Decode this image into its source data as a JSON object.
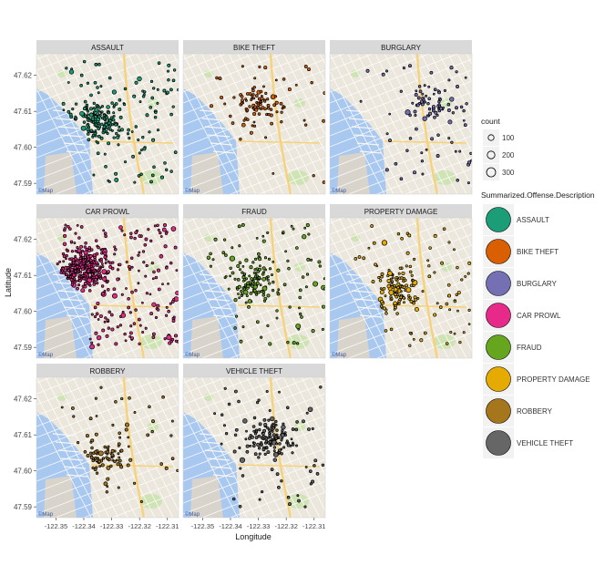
{
  "chart_data": {
    "type": "scatter",
    "subtype": "faceted map scatter (small multiples on street-map tiles)",
    "xlabel": "Longitude",
    "ylabel": "Latitude",
    "xlim": [
      -122.357,
      -122.306
    ],
    "ylim": [
      47.587,
      47.626
    ],
    "x_ticks": [
      -122.35,
      -122.34,
      -122.33,
      -122.32,
      -122.31
    ],
    "x_tick_labels": [
      "-122.35",
      "-122.34",
      "-122.33",
      "-122.32",
      "-122.31"
    ],
    "y_ticks": [
      47.59,
      47.6,
      47.61,
      47.62
    ],
    "y_tick_labels": [
      "47.59",
      "47.60",
      "47.61",
      "47.62"
    ],
    "grid": false,
    "legend_position": "right",
    "size_legend": {
      "title": "count",
      "breaks": [
        100,
        200,
        300
      ],
      "labels": [
        "100",
        "200",
        "300"
      ]
    },
    "color_legend": {
      "title": "Summarized.Offense.Description",
      "entries": [
        {
          "label": "ASSAULT",
          "color": "#1b9e77"
        },
        {
          "label": "BIKE THEFT",
          "color": "#d95f02"
        },
        {
          "label": "BURGLARY",
          "color": "#7570b3"
        },
        {
          "label": "CAR PROWL",
          "color": "#e7298a"
        },
        {
          "label": "FRAUD",
          "color": "#66a61e"
        },
        {
          "label": "PROPERTY DAMAGE",
          "color": "#e6ab02"
        },
        {
          "label": "ROBBERY",
          "color": "#a6761d"
        },
        {
          "label": "VEHICLE THEFT",
          "color": "#666666"
        }
      ]
    },
    "facets": [
      {
        "title": "ASSAULT",
        "color": "#1b9e77",
        "density": "high",
        "hotspot": [
          -122.335,
          47.607
        ]
      },
      {
        "title": "BIKE THEFT",
        "color": "#d95f02",
        "density": "low",
        "hotspot": [
          -122.33,
          47.611
        ]
      },
      {
        "title": "BURGLARY",
        "color": "#7570b3",
        "density": "low",
        "hotspot": [
          -122.32,
          47.612
        ]
      },
      {
        "title": "CAR PROWL",
        "color": "#e7298a",
        "density": "very high",
        "hotspot": [
          -122.34,
          47.612
        ]
      },
      {
        "title": "FRAUD",
        "color": "#66a61e",
        "density": "medium",
        "hotspot": [
          -122.332,
          47.608
        ]
      },
      {
        "title": "PROPERTY DAMAGE",
        "color": "#e6ab02",
        "density": "medium",
        "hotspot": [
          -122.333,
          47.606
        ]
      },
      {
        "title": "ROBBERY",
        "color": "#a6761d",
        "density": "low",
        "hotspot": [
          -122.333,
          47.604
        ]
      },
      {
        "title": "VEHICLE THEFT",
        "color": "#666666",
        "density": "medium",
        "hotspot": [
          -122.325,
          47.609
        ]
      }
    ],
    "map_attribution": "©Map"
  }
}
